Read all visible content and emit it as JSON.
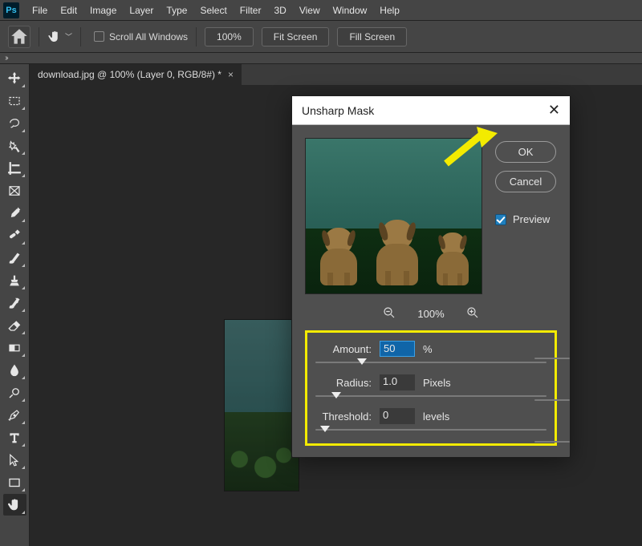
{
  "menubar": {
    "items": [
      "File",
      "Edit",
      "Image",
      "Layer",
      "Type",
      "Select",
      "Filter",
      "3D",
      "View",
      "Window",
      "Help"
    ]
  },
  "optionsbar": {
    "scroll_all_label": "Scroll All Windows",
    "zoom_value": "100%",
    "fit_screen": "Fit Screen",
    "fill_screen": "Fill Screen"
  },
  "expand_glyph": "››",
  "document": {
    "tab_label": "download.jpg @ 100% (Layer 0, RGB/8#) *"
  },
  "dialog": {
    "title": "Unsharp Mask",
    "ok": "OK",
    "cancel": "Cancel",
    "preview_label": "Preview",
    "preview_checked": true,
    "zoom_level": "100%",
    "params": {
      "amount": {
        "label": "Amount:",
        "value": "50",
        "unit": "%",
        "slider_pos_pct": 18
      },
      "radius": {
        "label": "Radius:",
        "value": "1.0",
        "unit": "Pixels",
        "slider_pos_pct": 7
      },
      "threshold": {
        "label": "Threshold:",
        "value": "0",
        "unit": "levels",
        "slider_pos_pct": 2
      }
    }
  },
  "toolbar": {
    "tools": [
      "move-tool",
      "rectangular-marquee-tool",
      "lasso-tool",
      "quick-selection-tool",
      "crop-tool",
      "frame-tool",
      "eyedropper-tool",
      "healing-brush-tool",
      "brush-tool",
      "clone-stamp-tool",
      "history-brush-tool",
      "eraser-tool",
      "gradient-tool",
      "blur-tool",
      "dodge-tool",
      "pen-tool",
      "type-tool",
      "path-selection-tool",
      "rectangle-tool",
      "hand-tool"
    ]
  }
}
